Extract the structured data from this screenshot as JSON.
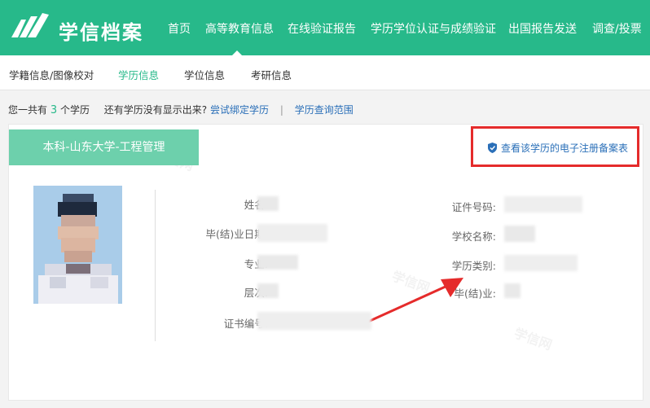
{
  "brand": {
    "name": "学信档案"
  },
  "nav": {
    "items": [
      "首页",
      "高等教育信息",
      "在线验证报告",
      "学历学位认证与成绩验证",
      "出国报告发送",
      "调查/投票"
    ]
  },
  "subnav": {
    "items": [
      "学籍信息/图像校对",
      "学历信息",
      "学位信息",
      "考研信息"
    ],
    "active": "学历信息"
  },
  "info": {
    "prefix": "您一共有",
    "count": "3",
    "suffix": "个学历",
    "question": "还有学历没有显示出来?",
    "bind_link": "尝试绑定学历",
    "separator": "|",
    "scope_link": "学历查询范围"
  },
  "card": {
    "degree_title": "本科-山东大学-工程管理",
    "register_link": "查看该学历的电子注册备案表",
    "fields_left": [
      "姓名:",
      "毕(结)业日期:",
      "专业:",
      "层次:",
      "证书编号:"
    ],
    "fields_right": [
      "证件号码:",
      "学校名称:",
      "学历类别:",
      "毕(结)业:"
    ],
    "watermark": "学信网"
  },
  "colors": {
    "brand_green": "#27b98a",
    "tag_green": "#6dd0ac",
    "link_blue": "#2a6fb8",
    "annotation_red": "#e52b2b"
  }
}
